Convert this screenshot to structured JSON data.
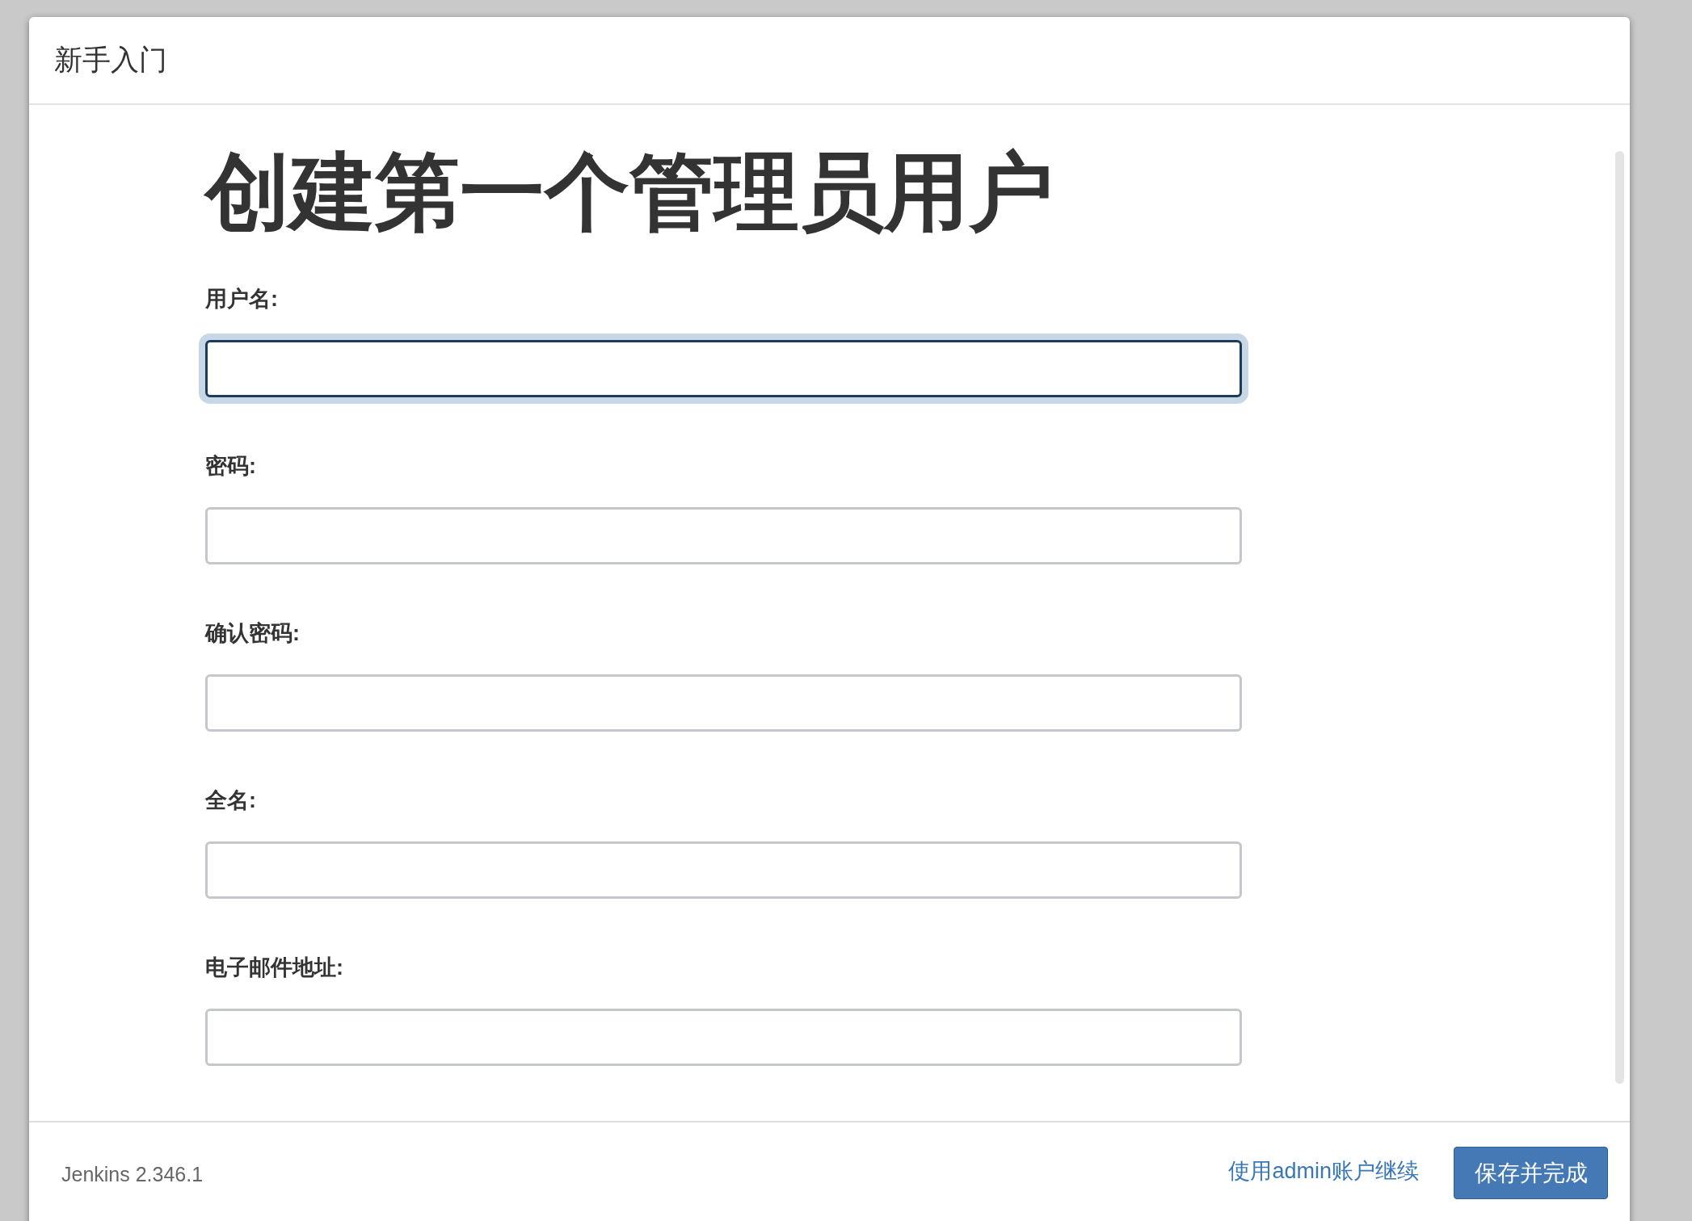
{
  "dialog": {
    "title": "新手入门"
  },
  "heading": "创建第一个管理员用户",
  "fields": [
    {
      "label": "用户名:",
      "focused": true
    },
    {
      "label": "密码:",
      "focused": false
    },
    {
      "label": "确认密码:",
      "focused": false
    },
    {
      "label": "全名:",
      "focused": false
    },
    {
      "label": "电子邮件地址:",
      "focused": false
    }
  ],
  "footer": {
    "version": "Jenkins 2.346.1",
    "link": "使用admin账户继续",
    "button": "保存并完成"
  }
}
